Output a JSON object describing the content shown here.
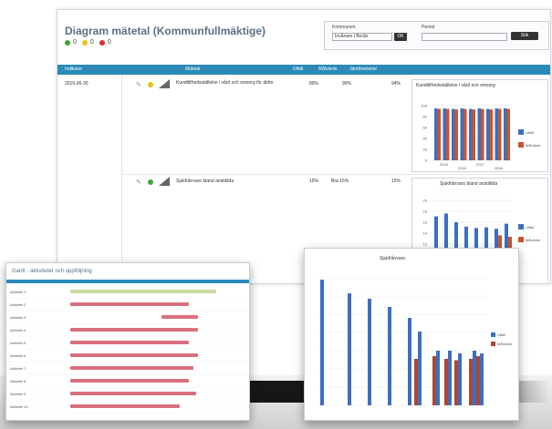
{
  "main": {
    "title": "Diagram mätetal (Kommunfullmäktige)",
    "legend": [
      {
        "label": "0",
        "color": "#3ca83a"
      },
      {
        "label": "0",
        "color": "#e8c21c"
      },
      {
        "label": "0",
        "color": "#d9322c"
      }
    ],
    "filter": {
      "label1": "Kommunen",
      "select1": "Invånare i Borås",
      "label2": "Period",
      "button1": "OK",
      "button2": "Sök"
    },
    "header": {
      "col1": "Indikator",
      "col2": "Mätetal",
      "col3": "Utfall",
      "col4": "Målvärde",
      "col5": "Jämförelsetal"
    },
    "left_cell": "2015-06-30",
    "rows": [
      {
        "status_color": "#e8c21c",
        "text": "Kundtillfredsställelse i vård och omsorg för äldre",
        "v1": "89%",
        "v2": "90%",
        "v3": "94%"
      },
      {
        "status_color": "#3ca83a",
        "text": "Sjukfrånvaro bland anställda",
        "v1": "15%",
        "v2": "Bra 15%",
        "v3": "15%"
      }
    ],
    "chart1": {
      "title": "Kundtillfredsställelse i vård och omsorg",
      "legend": [
        {
          "label": "Utfall",
          "color": "#3d6fbf"
        },
        {
          "label": "Målvärde",
          "color": "#c9552e"
        }
      ],
      "yticks": [
        "100",
        "80",
        "60",
        "40",
        "20",
        "0"
      ],
      "xticks": [
        "2015",
        "2016",
        "2017",
        "2018"
      ]
    },
    "chart2": {
      "title": "Sjukfrånvaro bland anställda",
      "legend": [
        {
          "label": "Utfall",
          "color": "#3d6fbf"
        },
        {
          "label": "Målvärde",
          "color": "#c9552e"
        }
      ],
      "yticks": [
        "20",
        "18",
        "16",
        "14",
        "12",
        "10"
      ]
    }
  },
  "win2": {
    "title": "Gantt - aktiviteter och uppföljning",
    "rows": [
      {
        "label": "Aktivitet 1",
        "type": "green"
      },
      {
        "label": "Aktivitet 2",
        "type": "pink"
      },
      {
        "label": "Aktivitet 3",
        "type": "pink"
      },
      {
        "label": "Aktivitet 4",
        "type": "pink"
      },
      {
        "label": "Aktivitet 5",
        "type": "pink"
      },
      {
        "label": "Aktivitet 6",
        "type": "pink"
      },
      {
        "label": "Aktivitet 7",
        "type": "pink"
      },
      {
        "label": "Aktivitet 8",
        "type": "pink"
      },
      {
        "label": "Aktivitet 9",
        "type": "pink"
      },
      {
        "label": "Aktivitet 10",
        "type": "pink"
      }
    ]
  },
  "win3": {
    "title": "Sjukfrånvaro",
    "legend": [
      {
        "label": "Utfall",
        "color": "#3d6fbf"
      },
      {
        "label": "Målvärde",
        "color": "#a8473a"
      }
    ]
  }
}
